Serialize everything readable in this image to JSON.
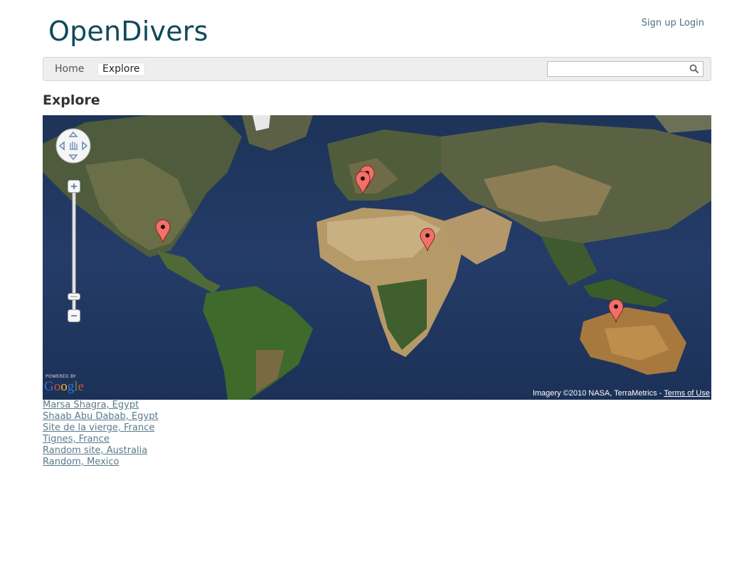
{
  "header": {
    "logo": "OpenDivers",
    "signup": "Sign up",
    "login": "Login"
  },
  "nav": {
    "home": "Home",
    "explore": "Explore",
    "search_value": ""
  },
  "page": {
    "title": "Explore"
  },
  "map": {
    "powered_small": "POWERED BY",
    "powered_logo": "Google",
    "attribution": "Imagery ©2010 NASA, TerraMetrics - ",
    "terms": "Terms of Use",
    "marker_color": "#f2706a"
  },
  "sites": [
    "Marsa Shagra, Egypt",
    "Shaab Abu Dabab, Egypt",
    "Site de la vierge, France",
    "Tignes, France",
    "Random site, Australia",
    "Random, Mexico"
  ],
  "colors": {
    "logo": "#0d4a5a",
    "link": "#5b7a8c",
    "ocean": "#22375e"
  }
}
